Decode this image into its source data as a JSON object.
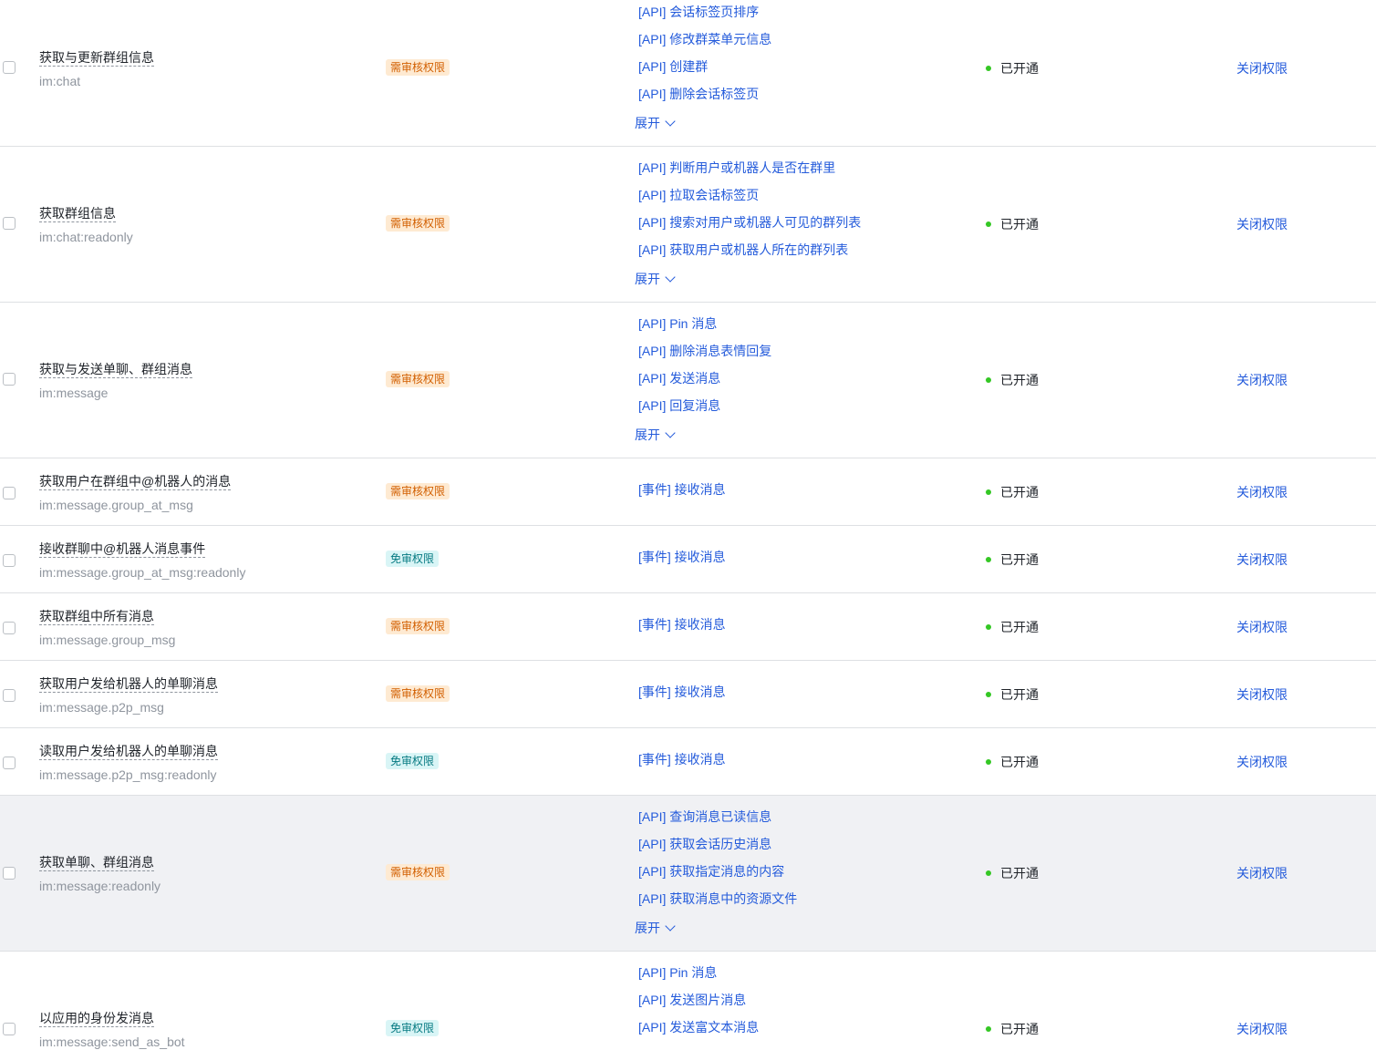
{
  "colors": {
    "link": "#245bdb",
    "status_dot": "#34c724",
    "tag_review_bg": "#feead2",
    "tag_review_text": "#d25f00",
    "tag_free_bg": "#d9f5f6",
    "tag_free_text": "#067a82",
    "row_hover_bg": "#f0f1f4"
  },
  "labels": {
    "expand": "展开",
    "status_enabled": "已开通",
    "action_close": "关闭权限"
  },
  "rows": [
    {
      "name": "获取与更新群组信息",
      "scope": "im:chat",
      "tag": "需审核权限",
      "apis": [
        "[API] 会话标签页排序",
        "[API] 修改群菜单元信息",
        "[API] 创建群",
        "[API] 删除会话标签页"
      ]
    },
    {
      "name": "获取群组信息",
      "scope": "im:chat:readonly",
      "tag": "需审核权限",
      "apis": [
        "[API] 判断用户或机器人是否在群里",
        "[API] 拉取会话标签页",
        "[API] 搜索对用户或机器人可见的群列表",
        "[API] 获取用户或机器人所在的群列表"
      ]
    },
    {
      "name": "获取与发送单聊、群组消息",
      "scope": "im:message",
      "tag": "需审核权限",
      "apis": [
        "[API] Pin 消息",
        "[API] 删除消息表情回复",
        "[API] 发送消息",
        "[API] 回复消息"
      ]
    },
    {
      "name": "获取用户在群组中@机器人的消息",
      "scope": "im:message.group_at_msg",
      "tag": "需审核权限",
      "apis": [
        "[事件] 接收消息"
      ]
    },
    {
      "name": "接收群聊中@机器人消息事件",
      "scope": "im:message.group_at_msg:readonly",
      "tag": "免审权限",
      "apis": [
        "[事件] 接收消息"
      ]
    },
    {
      "name": "获取群组中所有消息",
      "scope": "im:message.group_msg",
      "tag": "需审核权限",
      "apis": [
        "[事件] 接收消息"
      ]
    },
    {
      "name": "获取用户发给机器人的单聊消息",
      "scope": "im:message.p2p_msg",
      "tag": "需审核权限",
      "apis": [
        "[事件] 接收消息"
      ]
    },
    {
      "name": "读取用户发给机器人的单聊消息",
      "scope": "im:message.p2p_msg:readonly",
      "tag": "免审权限",
      "apis": [
        "[事件] 接收消息"
      ]
    },
    {
      "name": "获取单聊、群组消息",
      "scope": "im:message:readonly",
      "tag": "需审核权限",
      "apis": [
        "[API] 查询消息已读信息",
        "[API] 获取会话历史消息",
        "[API] 获取指定消息的内容",
        "[API] 获取消息中的资源文件"
      ]
    },
    {
      "name": "以应用的身份发消息",
      "scope": "im:message:send_as_bot",
      "tag": "免审权限",
      "apis": [
        "[API] Pin 消息",
        "[API] 发送图片消息",
        "[API] 发送富文本消息"
      ]
    }
  ]
}
